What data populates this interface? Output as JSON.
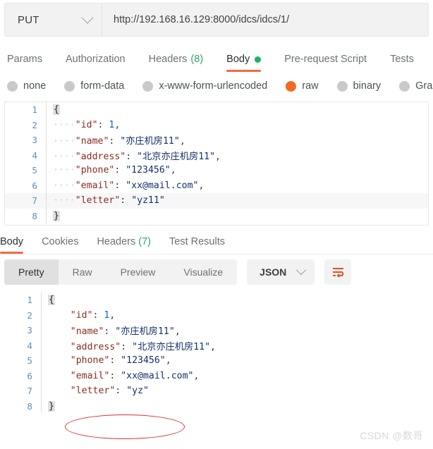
{
  "request": {
    "method": "PUT",
    "url": "http://192.168.16.129:8000/idcs/idcs/1/",
    "method_chevron_icon": "chevron-down-icon",
    "tabs": [
      {
        "label": "Params",
        "active": false
      },
      {
        "label": "Authorization",
        "active": false
      },
      {
        "label": "Headers",
        "count": "(8)",
        "active": false
      },
      {
        "label": "Body",
        "active": true,
        "dot": true
      },
      {
        "label": "Pre-request Script",
        "active": false
      },
      {
        "label": "Tests",
        "active": false
      }
    ],
    "body_types": [
      {
        "label": "none",
        "selected": false
      },
      {
        "label": "form-data",
        "selected": false
      },
      {
        "label": "x-www-form-urlencoded",
        "selected": false
      },
      {
        "label": "raw",
        "selected": true
      },
      {
        "label": "binary",
        "selected": false
      },
      {
        "label": "Gra",
        "selected": false
      }
    ],
    "body_lines": [
      {
        "n": "1",
        "indent": "",
        "content": "{",
        "brace": true
      },
      {
        "n": "2",
        "indent": "····",
        "key": "\"id\"",
        "sep": ": ",
        "value": "1",
        "value_type": "num",
        "tail": ","
      },
      {
        "n": "3",
        "indent": "····",
        "key": "\"name\"",
        "sep": ": ",
        "value": "\"亦庄机房11\"",
        "value_type": "str",
        "tail": ","
      },
      {
        "n": "4",
        "indent": "····",
        "key": "\"address\"",
        "sep": ": ",
        "value": "\"北京亦庄机房11\"",
        "value_type": "str",
        "tail": ","
      },
      {
        "n": "5",
        "indent": "····",
        "key": "\"phone\"",
        "sep": ": ",
        "value": "\"123456\"",
        "value_type": "str",
        "tail": ","
      },
      {
        "n": "6",
        "indent": "····",
        "key": "\"email\"",
        "sep": ": ",
        "value": "\"xx@mail.com\"",
        "value_type": "str",
        "tail": ","
      },
      {
        "n": "7",
        "indent": "····",
        "key": "\"letter\"",
        "sep": ": ",
        "value": "\"yz11\"",
        "value_type": "str",
        "tail": "",
        "highlight": true
      },
      {
        "n": "8",
        "indent": "",
        "content": "}",
        "brace": true
      }
    ]
  },
  "response": {
    "tabs": [
      {
        "label": "Body",
        "active": true
      },
      {
        "label": "Cookies",
        "active": false
      },
      {
        "label": "Headers",
        "count": "(7)",
        "active": false
      },
      {
        "label": "Test Results",
        "active": false
      }
    ],
    "view_modes": [
      {
        "label": "Pretty",
        "active": true
      },
      {
        "label": "Raw",
        "active": false
      },
      {
        "label": "Preview",
        "active": false
      },
      {
        "label": "Visualize",
        "active": false
      }
    ],
    "format": "JSON",
    "format_chevron_icon": "chevron-down-icon",
    "wrap_icon": "wrap-lines-icon",
    "body_lines": [
      {
        "n": "1",
        "indent": "",
        "content": "{",
        "brace": true
      },
      {
        "n": "2",
        "indent": "    ",
        "key": "\"id\"",
        "sep": ": ",
        "value": "1",
        "value_type": "num",
        "tail": ","
      },
      {
        "n": "3",
        "indent": "    ",
        "key": "\"name\"",
        "sep": ": ",
        "value": "\"亦庄机房11\"",
        "value_type": "str",
        "tail": ","
      },
      {
        "n": "4",
        "indent": "    ",
        "key": "\"address\"",
        "sep": ": ",
        "value": "\"北京亦庄机房11\"",
        "value_type": "str",
        "tail": ","
      },
      {
        "n": "5",
        "indent": "    ",
        "key": "\"phone\"",
        "sep": ": ",
        "value": "\"123456\"",
        "value_type": "str",
        "tail": ","
      },
      {
        "n": "6",
        "indent": "    ",
        "key": "\"email\"",
        "sep": ": ",
        "value": "\"xx@mail.com\"",
        "value_type": "str",
        "tail": ","
      },
      {
        "n": "7",
        "indent": "    ",
        "key": "\"letter\"",
        "sep": ": ",
        "value": "\"yz\"",
        "value_type": "str",
        "tail": ""
      },
      {
        "n": "8",
        "indent": "",
        "content": "}",
        "brace": true
      }
    ]
  },
  "annotation": {
    "shape": "ellipse",
    "color": "#e02b2b"
  },
  "watermark": "CSDN @数哥",
  "colors": {
    "accent_orange": "#f26b3a",
    "radio_selected": "#f4691f",
    "count_green": "#2fa868",
    "body_dot_green": "#15b75c",
    "annotation_red": "#e02b2b"
  }
}
